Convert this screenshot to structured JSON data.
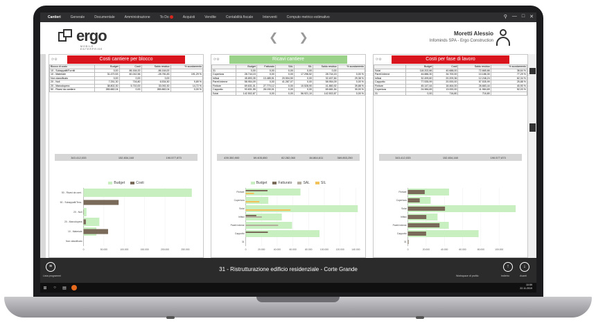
{
  "menu": {
    "items": [
      "Cantieri",
      "Generale",
      "Documentale",
      "Amministrazione",
      "To Do",
      "Acquisti",
      "Vendite",
      "Contabilità fiscale",
      "Interventi",
      "Computo metrico estimativo"
    ]
  },
  "header": {
    "logo": "ergo",
    "logo_sub_1": "MOBILE",
    "logo_sub_2": "ENTERPRISE",
    "user_name": "Moretti Alessio",
    "company": "Infominds SPA - Ergo Construction"
  },
  "colors": {
    "red": "#d9141d",
    "green": "#9ad28a",
    "bar_green": "#c8efc0",
    "bar_brown": "#7a6a5a",
    "bar_gray": "#b5ad9e",
    "bar_orange": "#f2c25a"
  },
  "panel1": {
    "title": "Costi cantiere per blocco",
    "headers": [
      "Blocco di costo",
      "Budget",
      "Costi",
      "Saldo residuo",
      "% scostamento"
    ],
    "rows": [
      [
        "10 - Subappalti/Forniti",
        "0,00",
        "86.164,00",
        "-86.164,00",
        ""
      ],
      [
        "10 - Materiale",
        "31.470,53",
        "60.242,56",
        "-28.781,83",
        "191,29 %"
      ],
      [
        "Non classificato",
        "0,00",
        "0,00",
        "0,00",
        ""
      ],
      [
        "20 - Noli",
        "7.251,30",
        "716,80",
        "6.534,50",
        "9,89 %"
      ],
      [
        "20 - Manodopera",
        "38.802,30",
        "5.710,00",
        "33.092,30",
        "14,72 %"
      ],
      [
        "50 - Ricavi da cantiere",
        "265.882,04",
        "0,00",
        "265.882,04",
        "0,00 %"
      ]
    ],
    "totals": [
      "343.412,033",
      "152.834,160",
      "190.577,873"
    ],
    "legend": [
      "Budget",
      "Costi"
    ],
    "chart_data": {
      "type": "bar",
      "categories": [
        "50 - Ricavi da cant..",
        "50 - Subappalti/Tera..",
        "20 - Noli",
        "20 - Manodopera",
        "10 - Materiale",
        "Non classificato"
      ],
      "series": [
        {
          "name": "Budget",
          "values": [
            265882,
            0,
            7251,
            38802,
            31470,
            0
          ]
        },
        {
          "name": "Costi",
          "values": [
            0,
            86164,
            717,
            5710,
            60243,
            0
          ]
        }
      ],
      "xlim": [
        0,
        280000
      ],
      "ticks": [
        "0",
        "50.000",
        "100.000",
        "150.000",
        "200.000",
        "250.000"
      ]
    }
  },
  "panel2": {
    "title": "Ricavi cantiere",
    "headers": [
      "",
      "Budget",
      "Fatturato",
      "SAL",
      "SIL",
      "Saldo residuo",
      "% scostamento"
    ],
    "rows": [
      [
        "31",
        "0,00",
        "0,00",
        "0,00",
        "0,00",
        "0,00",
        ""
      ],
      [
        "Copertura",
        "28.744,15",
        "0,00",
        "0,00",
        "17.296,52",
        "28.744,15",
        "0,00 %"
      ],
      [
        "Infissi",
        "45.893,35",
        "13.485,51",
        "20.504,50",
        "0,00",
        "32.407,84",
        "29,38 %"
      ],
      [
        "Pareti interne",
        "58.954,09",
        "0,00",
        "41.287,07",
        "0,00",
        "58.954,09",
        "0,00 %"
      ],
      [
        "Finiture",
        "69.631,01",
        "27.770,12",
        "0,00",
        "10.528,90",
        "41.860,92",
        "39,88 %"
      ],
      [
        "Cappotto",
        "93.831,55",
        "28.150,01",
        "0,00",
        "0,00",
        "65.681,54",
        "30,00 %"
      ],
      [
        "Solai",
        "142.502,87",
        "0,00",
        "0,00",
        "56.921,10",
        "142.502,87",
        "0,00 %"
      ]
    ],
    "totals": [
      "439.350,900",
      "69.405,650",
      "82.282,060",
      "84.864,611",
      "369.853,250"
    ],
    "legend": [
      "Budget",
      "Fatturato",
      "SAL",
      "SIL"
    ],
    "chart_data": {
      "type": "bar",
      "categories": [
        "Finiture",
        "Copertura",
        "Solai",
        "Infissi",
        "Pareti interne",
        "Cappotto",
        "31"
      ],
      "series": [
        {
          "name": "Budget",
          "values": [
            69631,
            28744,
            142503,
            45893,
            58954,
            93832,
            0
          ]
        },
        {
          "name": "Fatturato",
          "values": [
            27770,
            0,
            0,
            13486,
            0,
            28150,
            0
          ]
        },
        {
          "name": "SAL",
          "values": [
            0,
            0,
            0,
            20505,
            41287,
            0,
            0
          ]
        },
        {
          "name": "SIL",
          "values": [
            10529,
            17297,
            56921,
            0,
            0,
            0,
            0
          ]
        }
      ],
      "xlim": [
        0,
        145000
      ],
      "ticks": [
        "0",
        "20.000",
        "40.000",
        "60.000",
        "80.000",
        "100.000",
        "120.000",
        "140.000"
      ]
    }
  },
  "panel3": {
    "title": "Costi per fase di lavoro",
    "headers": [
      "",
      "Budget",
      "Costi",
      "Saldo residuo",
      "% scostamento"
    ],
    "rows": [
      [
        "Solai",
        "118.202,66",
        "40.688,00",
        "72.665,66",
        "38,64 %"
      ],
      [
        "Pareti interne",
        "44.886,30",
        "34.700,00",
        "10.186,30",
        "77,29 %"
      ],
      [
        "Infissi",
        "32.499,60",
        "20.209,36",
        "12.248,24",
        "62,34 %"
      ],
      [
        "Cappotto",
        "77.535,99",
        "20.000,00",
        "57.535,99",
        "25,88 %"
      ],
      [
        "Finiture",
        "45.147,44",
        "18.464,00",
        "26.683,44",
        "40,90 %"
      ],
      [
        "Copertura",
        "24.984,69",
        "13.000,00",
        "11.984,69",
        "52,03 %"
      ],
      [
        "31",
        "0,00",
        "716,80",
        "716,80",
        ""
      ]
    ],
    "totals": [
      "343.412,033",
      "152.834,160",
      "190.577,873"
    ],
    "chart_data": {
      "type": "bar",
      "categories": [
        "Finiture",
        "Copertura",
        "Solai",
        "Infissi",
        "Pareti interne",
        "Cappotto",
        "31"
      ],
      "series": [
        {
          "name": "Budget",
          "values": [
            45147,
            24985,
            118203,
            32500,
            44886,
            77536,
            0
          ]
        },
        {
          "name": "Costi",
          "values": [
            18464,
            13000,
            40688,
            20209,
            34700,
            20000,
            717
          ]
        }
      ],
      "xlim": [
        0,
        125000
      ],
      "ticks": [
        "0",
        "20.000",
        "40.000",
        "60.000",
        "80.000",
        "100.000"
      ]
    }
  },
  "footer": {
    "title": "31 - Ristrutturazione  edificio residenziale - Corte Grande",
    "left_label": "Lista programmi",
    "workspace": "Workspace di profilo",
    "back": "Indietro",
    "forward": "Avanti"
  },
  "taskbar": {
    "time": "10:59",
    "date": "22.11.2019"
  }
}
